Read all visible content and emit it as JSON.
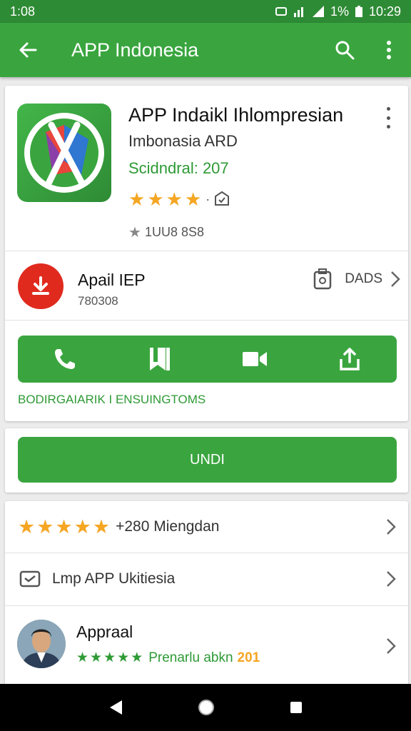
{
  "status_bar": {
    "time_left": "1:08",
    "battery_pct": "1%",
    "time_right": "10:29"
  },
  "app_bar": {
    "title": "APP Indonesia"
  },
  "app": {
    "name": "APP Indaikl Ihlompresian",
    "developer": "Imbonasia ARD",
    "category": "Scidndral: 207",
    "rating_stars": 4,
    "downloads": "1UU8 8S8"
  },
  "install": {
    "title": "Apail IEP",
    "subtitle": "780308",
    "data_label": "DADS"
  },
  "tagline": "BODIRGAIARIK I ENSUINGTOMS",
  "main_button": {
    "label": "UNDI"
  },
  "list": {
    "ratings_text": "+280 Miengdan",
    "row2_text": "Lmp APP Ukitiesia",
    "review_name": "Appraal",
    "review_text": "Prenarlu abkn",
    "review_badge": "201"
  },
  "colors": {
    "primary": "#3aa53f",
    "primary_dark": "#2e8b35",
    "accent_red": "#e02a1e",
    "star": "#f5a623"
  }
}
